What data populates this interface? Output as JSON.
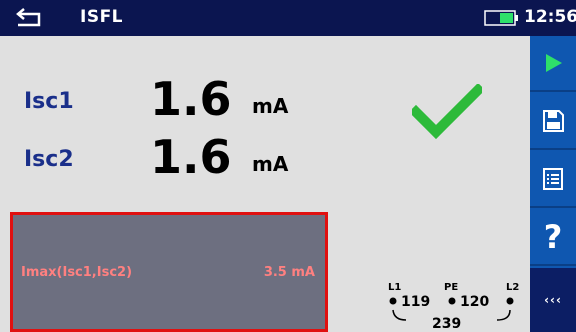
{
  "header": {
    "title": "ISFL",
    "time": "12:56",
    "back_icon": "back-arrow-icon",
    "battery_icon": "battery-icon"
  },
  "results": [
    {
      "label": "Isc1",
      "value": "1.6",
      "unit": "mA"
    },
    {
      "label": "Isc2",
      "value": "1.6",
      "unit": "mA"
    }
  ],
  "status": {
    "icon": "check-icon",
    "color": "#2dba3a"
  },
  "limit": {
    "label": "Imax(Isc1,Isc2)",
    "value": "3.5 mA",
    "color": "#ff8080",
    "border_color": "#e01010"
  },
  "terminal": {
    "l1": "L1",
    "pe": "PE",
    "l2": "L2",
    "v_l1_pe": "119",
    "v_pe_l2": "120",
    "v_l1_l2": "239"
  },
  "sidebar": {
    "buttons": [
      {
        "icon": "play-icon"
      },
      {
        "icon": "save-icon"
      },
      {
        "icon": "list-icon"
      },
      {
        "icon": "help-icon",
        "label": "?"
      },
      {
        "icon": "more-icon",
        "label": "‹‹‹"
      }
    ]
  },
  "colors": {
    "header_bg": "#0b1550",
    "sidebar_bg": "#0f57b0",
    "label_blue": "#1a2f8a",
    "play_green": "#2ee06a"
  }
}
